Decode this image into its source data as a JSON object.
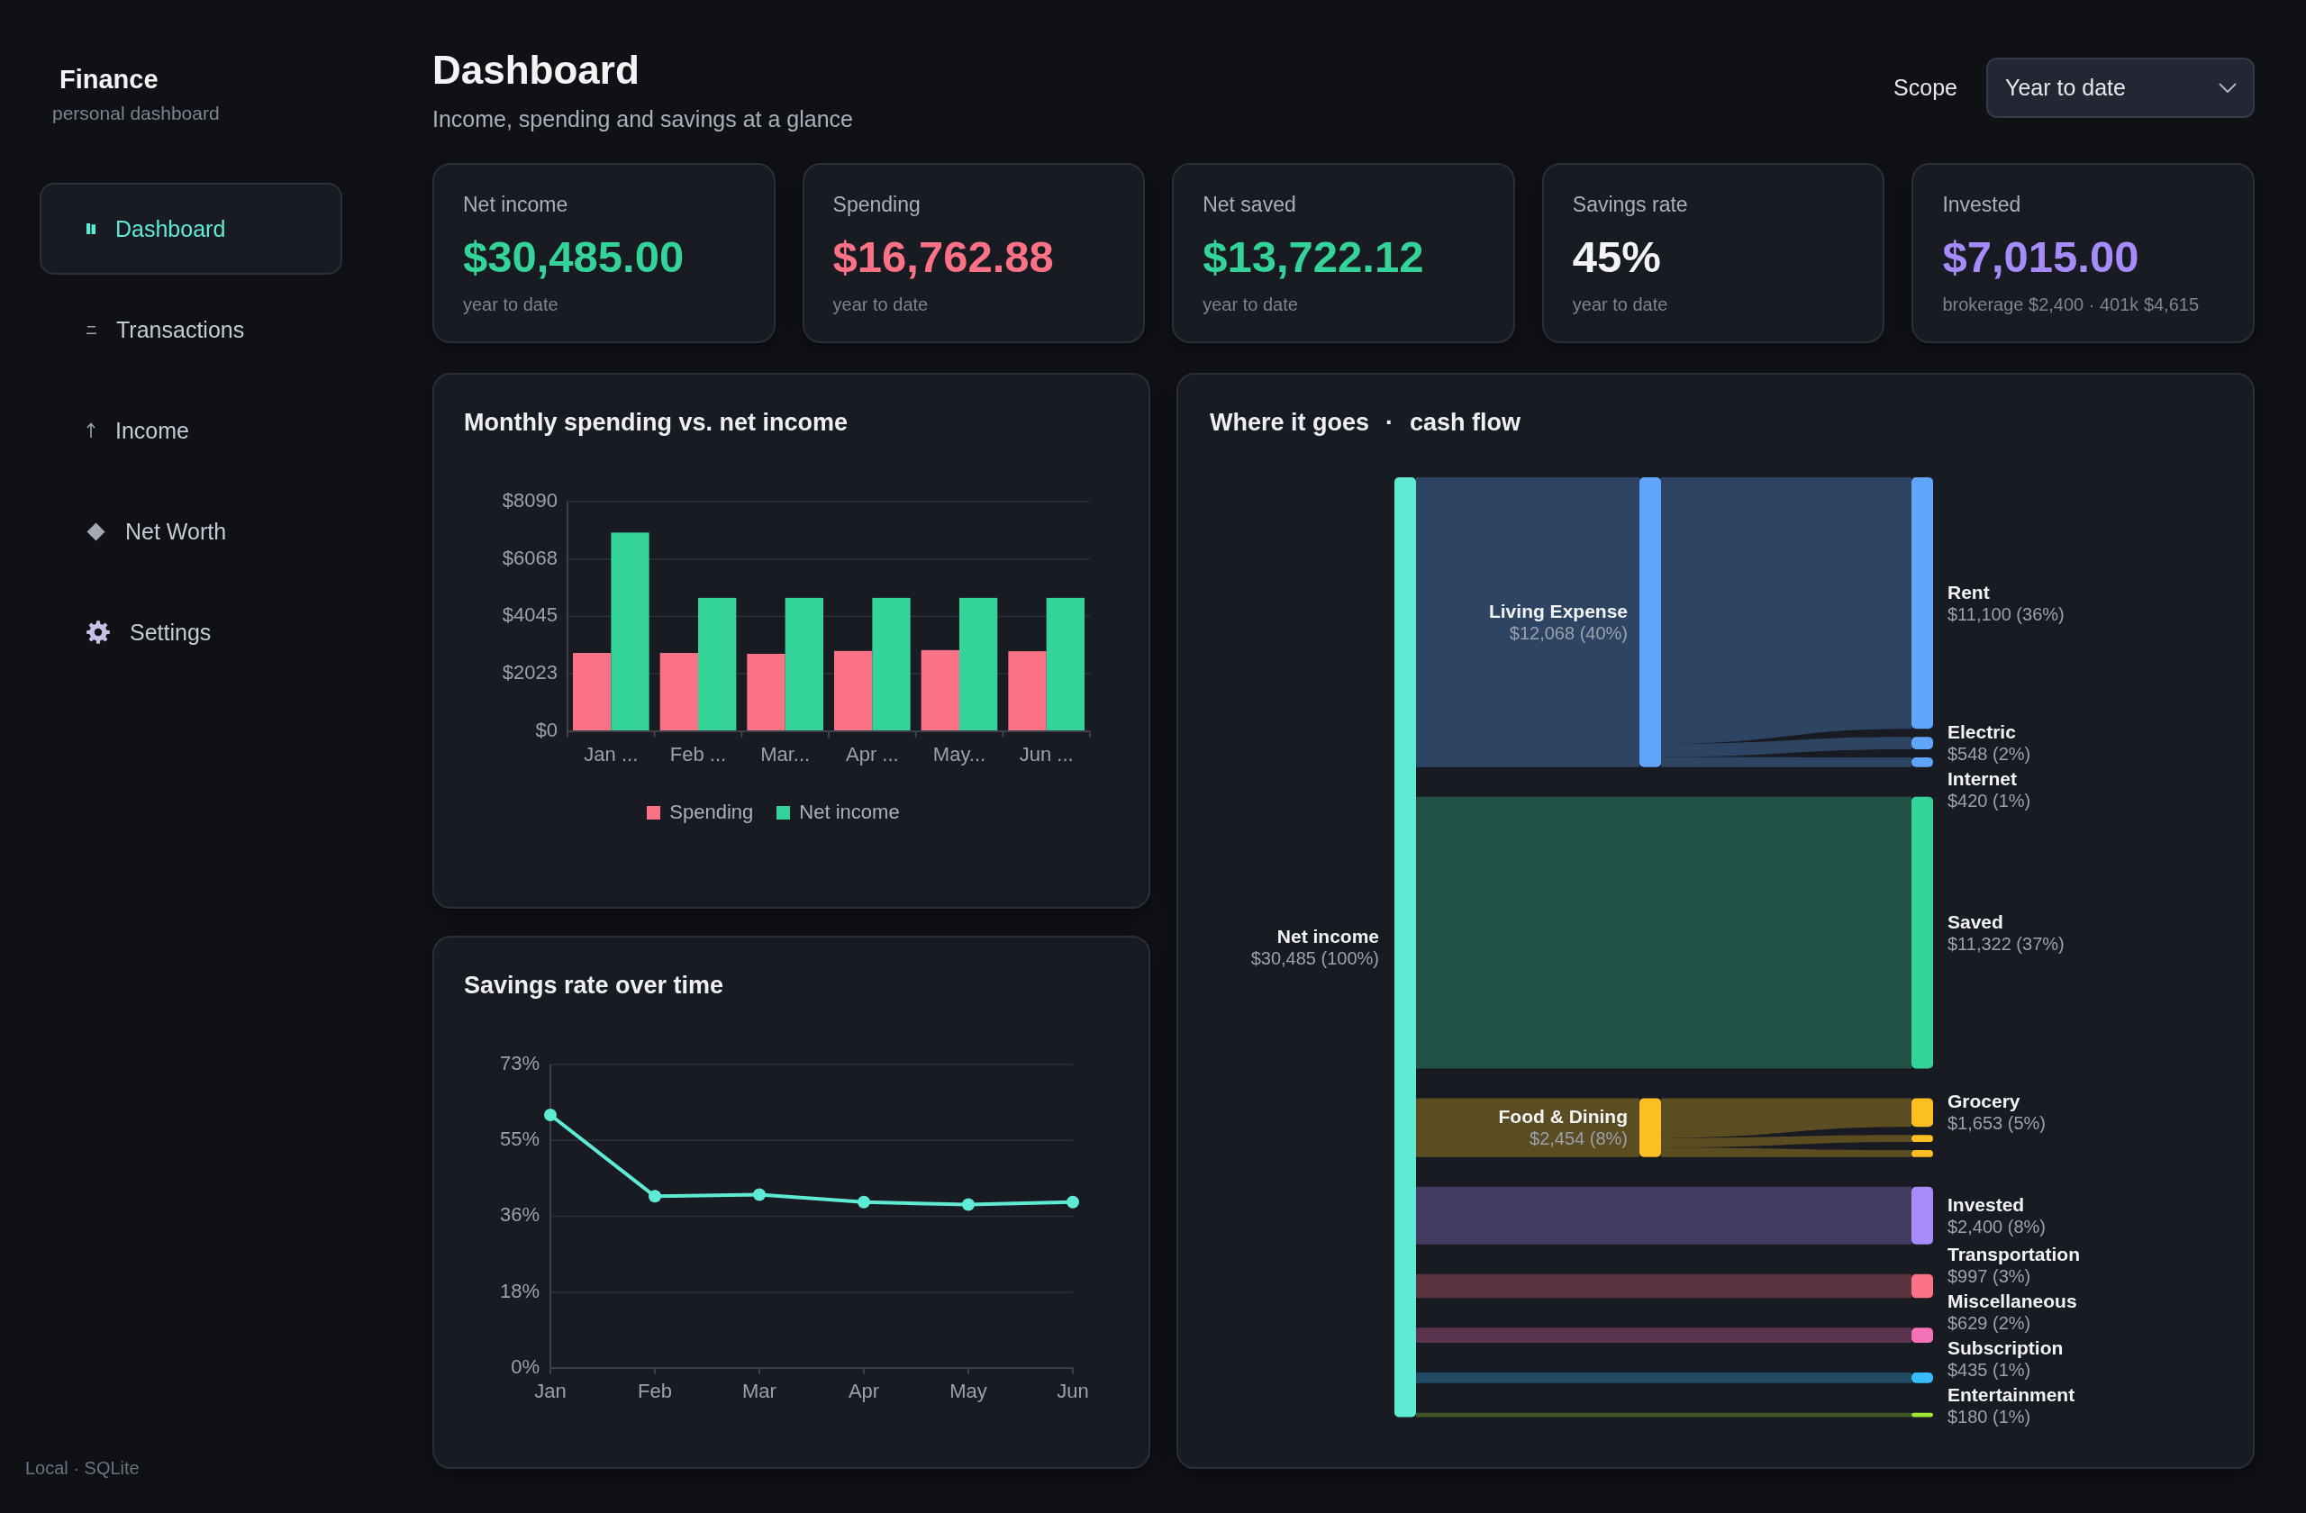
{
  "sidebar": {
    "brand": "Finance",
    "tagline": "personal dashboard",
    "nav": [
      {
        "label": "Dashboard",
        "selected": true
      },
      {
        "label": "Transactions",
        "selected": false
      },
      {
        "label": "Income",
        "selected": false
      },
      {
        "label": "Net Worth",
        "selected": false
      },
      {
        "label": "Settings",
        "selected": false
      }
    ],
    "footer": "Local · SQLite"
  },
  "header": {
    "title": "Dashboard",
    "subtitle": "Income, spending and savings at a glance",
    "scope": {
      "label": "Scope",
      "value": "Year to date"
    }
  },
  "stats": [
    {
      "label": "Net income",
      "value": "$30,485.00",
      "note": "year to date",
      "color": "#34d399"
    },
    {
      "label": "Spending",
      "value": "$16,762.88",
      "note": "year to date",
      "color": "#fb7185"
    },
    {
      "label": "Net saved",
      "value": "$13,722.12",
      "note": "year to date",
      "color": "#34d399"
    },
    {
      "label": "Savings rate",
      "value": "45%",
      "note": "year to date",
      "color": "#f3f4f6"
    },
    {
      "label": "Invested",
      "value": "$7,015.00",
      "note": "brokerage $2,400 · 401k $4,615",
      "color": "#a78bfa"
    }
  ],
  "spending_chart": {
    "title": "Monthly spending vs. net income",
    "chart_data": {
      "type": "bar",
      "categories": [
        "Jan ...",
        "Feb ...",
        "Mar...",
        "Apr ...",
        "May...",
        "Jun ..."
      ],
      "series": [
        {
          "name": "Spending",
          "color": "#fb7185",
          "values": [
            2760,
            2760,
            2730,
            2830,
            2860,
            2820
          ]
        },
        {
          "name": "Net income",
          "color": "#34d399",
          "values": [
            7000,
            4700,
            4700,
            4700,
            4700,
            4700
          ]
        }
      ],
      "ylim": [
        0,
        8090
      ],
      "yticks": [
        {
          "value": 0,
          "label": "$0"
        },
        {
          "value": 2022.5,
          "label": "$2023"
        },
        {
          "value": 4045,
          "label": "$4045"
        },
        {
          "value": 6067.5,
          "label": "$6068"
        },
        {
          "value": 8090,
          "label": "$8090"
        }
      ],
      "grid": true,
      "legend": "bottom"
    }
  },
  "savings_chart": {
    "title": "Savings rate over time",
    "chart_data": {
      "type": "line",
      "categories": [
        "Jan",
        "Feb",
        "Mar",
        "Apr",
        "May",
        "Jun"
      ],
      "series": [
        {
          "color": "#5eead4",
          "marker": "circle",
          "values": [
            60.7,
            41.2,
            41.6,
            39.8,
            39.2,
            39.8
          ]
        }
      ],
      "ylim": [
        0,
        72.8
      ],
      "yticks": [
        {
          "value": 0,
          "label": "0%"
        },
        {
          "value": 18.2,
          "label": "18%"
        },
        {
          "value": 36.4,
          "label": "36%"
        },
        {
          "value": 54.6,
          "label": "55%"
        },
        {
          "value": 72.8,
          "label": "73%"
        }
      ],
      "grid": true
    }
  },
  "cashflow": {
    "title": "Where it goes",
    "separator": "·",
    "subtitle": "cash flow",
    "source": {
      "label": "Net income",
      "amount": "$30,485 (100%)"
    },
    "flows": [
      {
        "kind": "group",
        "label": "Living Expense",
        "amount": "$12,068 (40%)",
        "color": "#60a5fa",
        "children": [
          {
            "kind": "labeled",
            "label": "Rent",
            "amount": "$11,100 (36%)"
          },
          {
            "kind": "labeled",
            "label": "Electric",
            "amount": "$548 (2%)"
          },
          {
            "kind": "labeled",
            "label": "Internet",
            "amount": "$420 (1%)"
          }
        ]
      },
      {
        "kind": "direct",
        "label": "Saved",
        "amount": "$11,322 (37%)",
        "color": "#34d399"
      },
      {
        "kind": "group",
        "label": "Food & Dining",
        "amount": "$2,454 (8%)",
        "color": "#fbbf24",
        "children": [
          {
            "kind": "labeled",
            "label": "Grocery",
            "amount": "$1,653 (5%)"
          },
          {
            "kind": "unlabeled"
          },
          {
            "kind": "unlabeled"
          }
        ]
      },
      {
        "kind": "direct",
        "label": "Invested",
        "amount": "$2,400 (8%)",
        "color": "#a78bfa"
      },
      {
        "kind": "direct",
        "label": "Transportation",
        "amount": "$997 (3%)",
        "color": "#fb7185"
      },
      {
        "kind": "direct",
        "label": "Miscellaneous",
        "amount": "$629 (2%)",
        "color": "#f472b6"
      },
      {
        "kind": "direct",
        "label": "Subscription",
        "amount": "$435 (1%)",
        "color": "#38bdf8"
      },
      {
        "kind": "direct",
        "label": "Entertainment",
        "amount": "$180 (1%)",
        "color": "#a3e635"
      }
    ]
  }
}
